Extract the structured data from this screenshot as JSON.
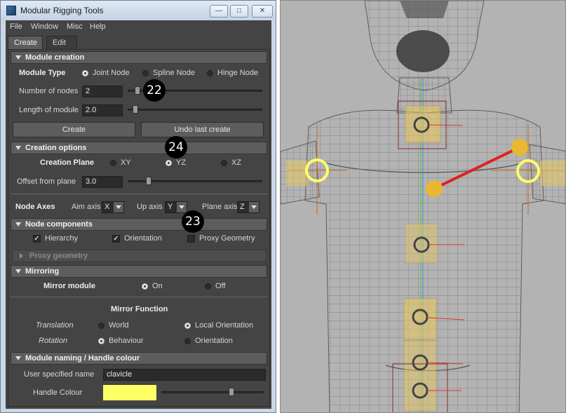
{
  "window": {
    "title": "Modular Rigging Tools",
    "controls": {
      "minimize": "—",
      "maximize": "□",
      "close": "✕"
    }
  },
  "menubar": [
    "File",
    "Window",
    "Misc",
    "Help"
  ],
  "tabs": [
    {
      "label": "Create",
      "active": true
    },
    {
      "label": "Edit",
      "active": false
    }
  ],
  "module_creation": {
    "header": "Module creation",
    "module_type_label": "Module Type",
    "module_types": [
      {
        "label": "Joint Node",
        "selected": true
      },
      {
        "label": "Spline Node",
        "selected": false
      },
      {
        "label": "Hinge Node",
        "selected": false
      }
    ],
    "number_of_nodes_label": "Number of nodes",
    "number_of_nodes_value": "2",
    "length_of_module_label": "Length of module",
    "length_of_module_value": "2.0",
    "create_button": "Create",
    "undo_button": "Undo last create"
  },
  "creation_options": {
    "header": "Creation options",
    "creation_plane_label": "Creation Plane",
    "planes": [
      {
        "label": "XY",
        "selected": false
      },
      {
        "label": "YZ",
        "selected": true
      },
      {
        "label": "XZ",
        "selected": false
      }
    ],
    "offset_label": "Offset from plane",
    "offset_value": "3.0",
    "node_axes_label": "Node Axes",
    "aim_axis_label": "Aim axis",
    "aim_axis_value": "X",
    "up_axis_label": "Up axis",
    "up_axis_value": "Y",
    "plane_axis_label": "Plane axis",
    "plane_axis_value": "Z"
  },
  "node_components": {
    "header": "Node components",
    "items": [
      {
        "label": "Hierarchy",
        "checked": true
      },
      {
        "label": "Orientation",
        "checked": true
      },
      {
        "label": "Proxy Geometry",
        "checked": false
      }
    ],
    "proxy_geometry_header": "Proxy geometry"
  },
  "mirroring": {
    "header": "Mirroring",
    "mirror_module_label": "Mirror module",
    "mirror_options": [
      {
        "label": "On",
        "selected": true
      },
      {
        "label": "Off",
        "selected": false
      }
    ],
    "mirror_function_label": "Mirror Function",
    "translation_label": "Translation",
    "translation_options": [
      {
        "label": "World",
        "selected": false
      },
      {
        "label": "Local Orientation",
        "selected": true
      }
    ],
    "rotation_label": "Rotation",
    "rotation_options": [
      {
        "label": "Behaviour",
        "selected": true
      },
      {
        "label": "Orientation",
        "selected": false
      }
    ]
  },
  "naming": {
    "header": "Module naming / Handle colour",
    "user_name_label": "User specified name",
    "user_name_value": "clavicle",
    "handle_colour_label": "Handle Colour",
    "handle_colour_hex": "#ffff66"
  },
  "callouts": [
    "22",
    "24",
    "23"
  ],
  "viewport": {
    "background": "#b3b3b3",
    "mesh_color": "#6f6f6f",
    "module_color": "#e8b830",
    "ring_color": "#ffff66"
  }
}
